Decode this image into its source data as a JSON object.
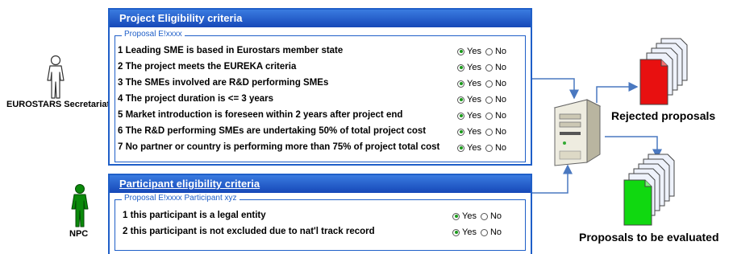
{
  "actors": {
    "secretariat": "EUROSTARS Secretariat",
    "npc": "NPC"
  },
  "project_panel": {
    "title": "Project Eligibility criteria",
    "legend": "Proposal E!xxxx",
    "criteria": [
      {
        "text": "1 Leading SME is based in Eurostars member state",
        "selected": "Yes"
      },
      {
        "text": "2 The project meets the EUREKA criteria",
        "selected": "Yes"
      },
      {
        "text": "3 The SMEs involved are R&D performing SMEs",
        "selected": "Yes"
      },
      {
        "text": "4 The project duration is <= 3 years",
        "selected": "Yes"
      },
      {
        "text": "5 Market introduction is foreseen within 2 years after project end",
        "selected": "Yes"
      },
      {
        "text": "6 The R&D performing SMEs are undertaking 50% of total project cost",
        "selected": "Yes"
      },
      {
        "text": "7 No partner or country is performing more than 75% of project total cost",
        "selected": "Yes"
      }
    ]
  },
  "participant_panel": {
    "title": "Participant eligibility criteria",
    "legend": "Proposal E!xxxx Participant xyz",
    "criteria": [
      {
        "text": "1 this participant is a legal entity",
        "selected": "Yes"
      },
      {
        "text": "2 this participant is not excluded due to nat'l track record",
        "selected": "Yes"
      }
    ]
  },
  "options": {
    "yes": "Yes",
    "no": "No"
  },
  "results": {
    "rejected": "Rejected proposals",
    "evaluated": "Proposals to be evaluated"
  },
  "colors": {
    "panel_blue": "#1f5fc8",
    "rejected_doc": "#e81010",
    "evaluated_doc": "#10d810",
    "npc_figure": "#0a8a0a"
  }
}
